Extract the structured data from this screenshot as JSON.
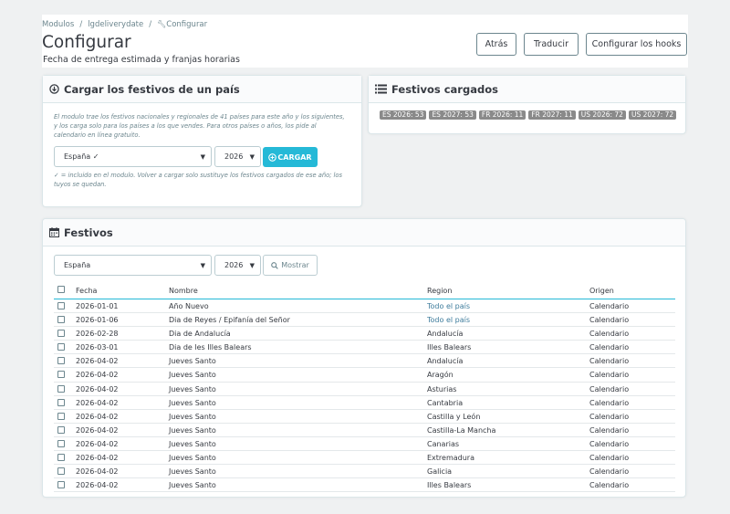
{
  "breadcrumb": {
    "items": [
      "Modulos",
      "lgdeliverydate",
      "Configurar"
    ]
  },
  "page": {
    "title": "Configurar",
    "subtitle": "Fecha de entrega estimada y franjas horarias"
  },
  "toolbar": {
    "back": "Atrás",
    "translate": "Traducir",
    "hooks": "Configurar los hooks"
  },
  "load_panel": {
    "title": "Cargar los festivos de un país",
    "info": "El modulo trae los festivos nacionales y regionales de 41 países para este año y los siguientes, y los carga solo para los países a los que vendes. Para otros países o años, los pide al calendario en línea gratuito.",
    "country_value": "España ✓",
    "year_value": "2026",
    "load_button": "CARGAR",
    "note": "✓ = incluido en el modulo. Volver a cargar solo sustituye los festivos cargados de ese año; los tuyos se quedan."
  },
  "loaded_panel": {
    "title": "Festivos cargados",
    "badges": [
      "ES 2026: 53",
      "ES 2027: 53",
      "FR 2026: 11",
      "FR 2027: 11",
      "US 2026: 72",
      "US 2027: 72"
    ]
  },
  "holidays_panel": {
    "title": "Festivos",
    "country_value": "España",
    "year_value": "2026",
    "show_button": "Mostrar",
    "columns": {
      "date": "Fecha",
      "name": "Nombre",
      "region": "Region",
      "origin": "Origen"
    },
    "rows": [
      {
        "date": "2026-01-01",
        "name": "Año Nuevo",
        "region": "Todo el país",
        "origin": "Calendario"
      },
      {
        "date": "2026-01-06",
        "name": "Dia de Reyes / Epifanía del Señor",
        "region": "Todo el país",
        "origin": "Calendario"
      },
      {
        "date": "2026-02-28",
        "name": "Dia de Andalucía",
        "region": "Andalucía",
        "origin": "Calendario"
      },
      {
        "date": "2026-03-01",
        "name": "Dia de les Illes Balears",
        "region": "Illes Balears",
        "origin": "Calendario"
      },
      {
        "date": "2026-04-02",
        "name": "Jueves Santo",
        "region": "Andalucía",
        "origin": "Calendario"
      },
      {
        "date": "2026-04-02",
        "name": "Jueves Santo",
        "region": "Aragón",
        "origin": "Calendario"
      },
      {
        "date": "2026-04-02",
        "name": "Jueves Santo",
        "region": "Asturias",
        "origin": "Calendario"
      },
      {
        "date": "2026-04-02",
        "name": "Jueves Santo",
        "region": "Cantabria",
        "origin": "Calendario"
      },
      {
        "date": "2026-04-02",
        "name": "Jueves Santo",
        "region": "Castilla y León",
        "origin": "Calendario"
      },
      {
        "date": "2026-04-02",
        "name": "Jueves Santo",
        "region": "Castilla-La Mancha",
        "origin": "Calendario"
      },
      {
        "date": "2026-04-02",
        "name": "Jueves Santo",
        "region": "Canarias",
        "origin": "Calendario"
      },
      {
        "date": "2026-04-02",
        "name": "Jueves Santo",
        "region": "Extremadura",
        "origin": "Calendario"
      },
      {
        "date": "2026-04-02",
        "name": "Jueves Santo",
        "region": "Galicia",
        "origin": "Calendario"
      },
      {
        "date": "2026-04-02",
        "name": "Jueves Santo",
        "region": "Illes Balears",
        "origin": "Calendario"
      }
    ]
  }
}
